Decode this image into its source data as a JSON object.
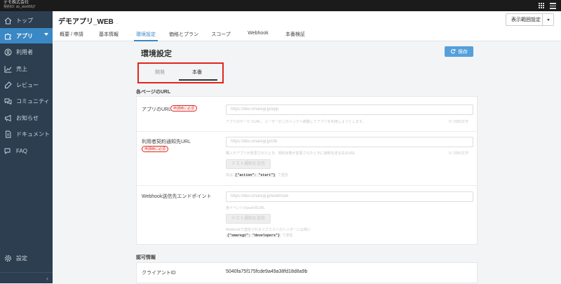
{
  "topbar": {
    "company": "デモ株式会社",
    "contract_id": "契約ID: sb_skx666j7",
    "apps_icon": "grid-icon",
    "menu_icon": "hamburger-icon"
  },
  "sidebar": {
    "items": [
      {
        "label": "トップ",
        "icon": "home-icon"
      },
      {
        "label": "アプリ",
        "icon": "puzzle-icon"
      },
      {
        "label": "利用者",
        "icon": "user-icon"
      },
      {
        "label": "売上",
        "icon": "chart-icon"
      },
      {
        "label": "レビュー",
        "icon": "review-icon"
      },
      {
        "label": "コミュニティ",
        "icon": "chat-icon"
      },
      {
        "label": "お知らせ",
        "icon": "megaphone-icon"
      },
      {
        "label": "ドキュメント",
        "icon": "document-icon"
      },
      {
        "label": "FAQ",
        "icon": "faq-icon"
      },
      {
        "label": "設定",
        "icon": "gear-icon"
      }
    ],
    "collapse_glyph": "‹"
  },
  "header": {
    "app_name": "デモアプリ_WEB",
    "app_dot": ".",
    "scope_button": "表示範囲設定",
    "tabs": [
      "概要 / 申請",
      "基本情報",
      "環境設定",
      "価格とプラン",
      "スコープ",
      "Webhook",
      "本番検証"
    ]
  },
  "main": {
    "title": "環境設定",
    "save_label": "保存",
    "env_tabs": [
      "開発",
      "本番"
    ],
    "urls_section": "各ページのURL",
    "required_badge": "申請時に必須",
    "app_url": {
      "label": "アプリのURL",
      "placeholder": "https://dev.smaregi.jp/app",
      "hint": "アプリのサービスURL。ユーザーがこのリンクへ移動してアプリを利用しようとします。",
      "counter": "0 / 2083文字"
    },
    "contract_url": {
      "label": "利用者契約通知先URL",
      "placeholder": "https://dev.smaregi.jp/ctb",
      "hint": "購入やアプリが変更されたとき、契約状態が変更されたときに通知を送る先のURL",
      "counter": "0 / 2083文字",
      "test_button": "テスト通知を送信",
      "note_prefix": "先は",
      "note_code": "{\"action\": \"start\"}",
      "note_suffix": "で送信"
    },
    "webhook_url": {
      "label": "Webhook送信先エンドポイント",
      "placeholder": "https://dev.smaregi.jp/webhook",
      "hint": "各イベントのpush先URL",
      "counter": "0 / 2083文字",
      "test_button": "テスト通知を送信",
      "note_line1": "Webhookで送信されるリクエストのヘッダーには常に",
      "note_code": "{\"smaregi\": \"developers\"}",
      "note_suffix": "で送信"
    },
    "auth_section": "認可情報",
    "client_id_label": "クライアントID",
    "client_id_value": "5040fa75f175fcde9a49a38fd18d8a9b"
  },
  "colors": {
    "sidebar_bg": "#2c3e50",
    "accent": "#3a88c5",
    "save_button": "#55a0db",
    "highlight_box": "#e0261c"
  }
}
